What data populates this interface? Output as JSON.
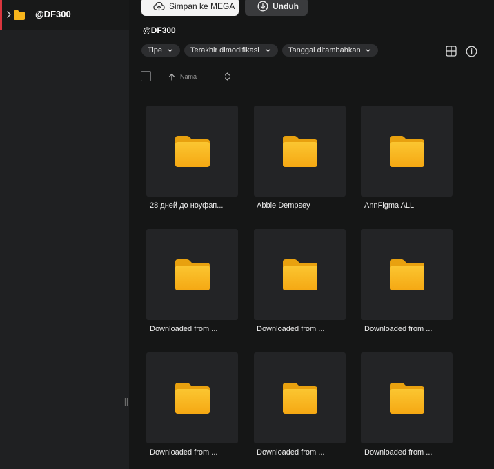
{
  "sidebar": {
    "items": [
      {
        "label": "@DF300",
        "icon": "folder-icon",
        "expanded": false,
        "active": true
      }
    ]
  },
  "toolbar": {
    "save_label": "Simpan ke MEGA",
    "download_label": "Unduh"
  },
  "page": {
    "title": "@DF300"
  },
  "filters": {
    "type_label": "Tipe",
    "modified_label": "Terakhir dimodifikasi",
    "added_label": "Tanggal ditambahkan"
  },
  "sort": {
    "label": "Nama",
    "direction": "ascending"
  },
  "folders": [
    {
      "name": "28 дней до ноуфап..."
    },
    {
      "name": "Abbie Dempsey"
    },
    {
      "name": "AnnFigma ALL"
    },
    {
      "name": "Downloaded from ..."
    },
    {
      "name": "Downloaded from ..."
    },
    {
      "name": "Downloaded from ..."
    },
    {
      "name": "Downloaded from ..."
    },
    {
      "name": "Downloaded from ..."
    },
    {
      "name": "Downloaded from ..."
    }
  ],
  "colors": {
    "accent": "#d9363e",
    "folder": "#f7b51c",
    "background": "#151616",
    "sidebar": "#1f2022",
    "tile": "#232426"
  }
}
